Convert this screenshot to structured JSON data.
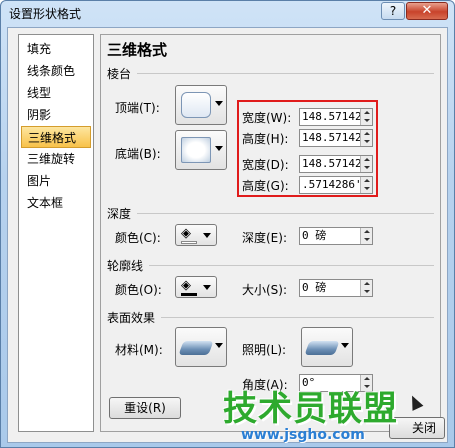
{
  "window": {
    "title": "设置形状格式",
    "help_label": "?",
    "close_label": "✕"
  },
  "nav": {
    "items": [
      {
        "label": "填充",
        "selected": false
      },
      {
        "label": "线条颜色",
        "selected": false
      },
      {
        "label": "线型",
        "selected": false
      },
      {
        "label": "阴影",
        "selected": false
      },
      {
        "label": "三维格式",
        "selected": true
      },
      {
        "label": "三维旋转",
        "selected": false
      },
      {
        "label": "图片",
        "selected": false
      },
      {
        "label": "文本框",
        "selected": false
      }
    ]
  },
  "panel": {
    "title": "三维格式",
    "bevel": {
      "section": "棱台",
      "top_label": "顶端(T):",
      "bottom_label": "底端(B):",
      "top_width_label": "宽度(W):",
      "top_width_value": "148.57142",
      "top_height_label": "高度(H):",
      "top_height_value": "148.57142",
      "bottom_width_label": "宽度(D):",
      "bottom_width_value": "148.57142",
      "bottom_height_label": "高度(G):",
      "bottom_height_value": ".5714286'"
    },
    "depth": {
      "section": "深度",
      "color_label": "颜色(C):",
      "depth_label": "深度(E):",
      "depth_value": "0 磅"
    },
    "contour": {
      "section": "轮廓线",
      "color_label": "颜色(O):",
      "size_label": "大小(S):",
      "size_value": "0 磅"
    },
    "surface": {
      "section": "表面效果",
      "material_label": "材料(M):",
      "lighting_label": "照明(L):",
      "angle_label": "角度(A):",
      "angle_value": "0°"
    },
    "reset_label": "重设(R)"
  },
  "footer": {
    "close_label": "关闭"
  },
  "watermark": {
    "main": "技术员联盟",
    "url": "www.jsgho.com"
  },
  "colors": {
    "accent_highlight": "#e01b1b",
    "selected_nav": "#f8c24a",
    "watermark_green": "#2eaa2e",
    "watermark_blue": "#2b7fd4"
  }
}
